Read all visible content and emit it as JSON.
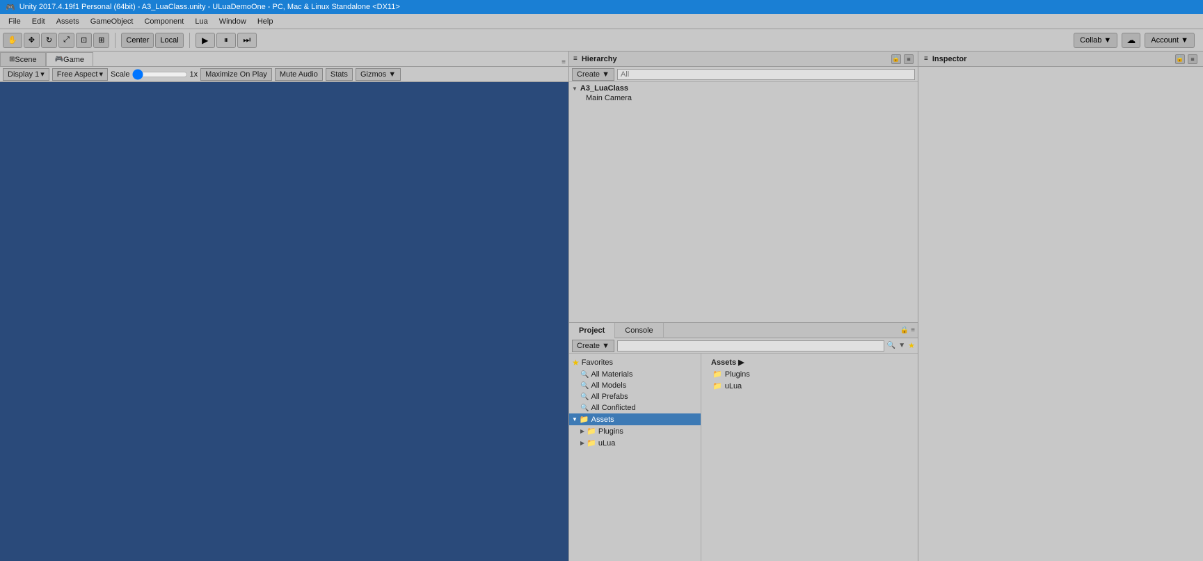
{
  "titlebar": {
    "text": "Unity 2017.4.19f1 Personal (64bit) - A3_LuaClass.unity - ULuaDemoOne - PC, Mac & Linux Standalone <DX11>"
  },
  "menubar": {
    "items": [
      "File",
      "Edit",
      "Assets",
      "GameObject",
      "Component",
      "Lua",
      "Window",
      "Help"
    ]
  },
  "toolbar": {
    "hand_tool": "✋",
    "move_tool": "✥",
    "rotate_tool": "↻",
    "scale_tool": "⤢",
    "rect_tool": "⊡",
    "transform_tool": "⊞",
    "center_label": "Center",
    "local_label": "Local",
    "play_icon": "▶",
    "pause_icon": "⏸",
    "step_icon": "⏭",
    "collab_label": "Collab ▼",
    "cloud_icon": "☁",
    "account_label": "Account ▼"
  },
  "scene_tabs": {
    "scene_label": "Scene",
    "game_label": "Game"
  },
  "game_toolbar": {
    "display_label": "Display 1",
    "aspect_label": "Free Aspect",
    "scale_label": "Scale",
    "scale_value": "1x",
    "maximize_label": "Maximize On Play",
    "mute_label": "Mute Audio",
    "stats_label": "Stats",
    "gizmos_label": "Gizmos ▼"
  },
  "hierarchy": {
    "panel_title": "Hierarchy",
    "create_label": "Create ▼",
    "search_placeholder": "All",
    "items": [
      {
        "label": "A3_LuaClass",
        "level": 0,
        "expanded": true,
        "has_arrow": true
      },
      {
        "label": "Main Camera",
        "level": 1,
        "expanded": false,
        "has_arrow": false
      }
    ]
  },
  "project": {
    "panel_title": "Project",
    "console_label": "Console",
    "create_label": "Create ▼",
    "search_placeholder": "",
    "favorites": {
      "label": "Favorites",
      "items": [
        {
          "label": "All Materials",
          "icon": "search"
        },
        {
          "label": "All Models",
          "icon": "search"
        },
        {
          "label": "All Prefabs",
          "icon": "search"
        },
        {
          "label": "All Conflicted",
          "icon": "search"
        }
      ]
    },
    "assets_tree": {
      "label": "Assets",
      "expanded": true,
      "children": [
        {
          "label": "Plugins",
          "expanded": false
        },
        {
          "label": "uLua",
          "expanded": false
        }
      ]
    },
    "assets_right": {
      "header": "Assets ▶",
      "items": [
        {
          "label": "Plugins",
          "icon": "folder"
        },
        {
          "label": "uLua",
          "icon": "folder"
        }
      ]
    }
  },
  "inspector": {
    "panel_title": "Inspector"
  }
}
